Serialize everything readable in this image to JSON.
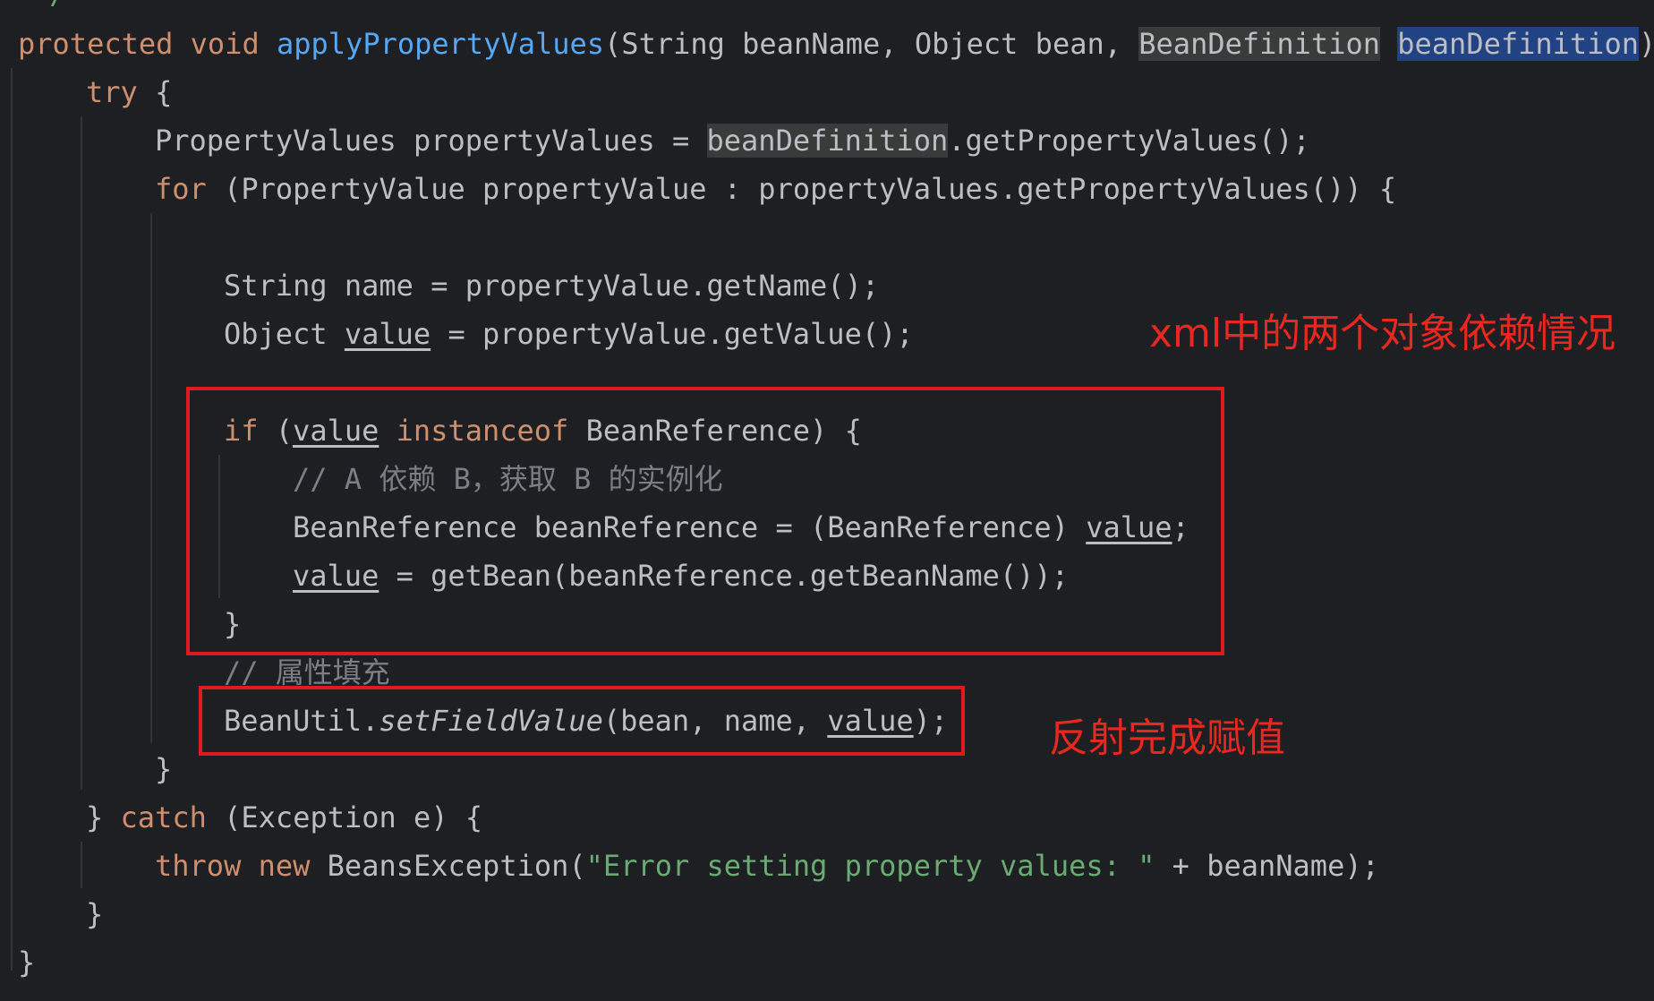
{
  "top_stub": "*/",
  "code": {
    "l1": {
      "mod": "protected",
      "ret": "void",
      "name": "applyPropertyValues",
      "p1": "(String beanName, Object bean, ",
      "ptype": "BeanDefinition",
      "pname": "beanDefinition",
      "close": ")"
    },
    "l2": {
      "kw": "try",
      "rest": " {"
    },
    "l3": {
      "a": "PropertyValues propertyValues = ",
      "b": "beanDefinition",
      "c": ".getPropertyValues();"
    },
    "l4": {
      "kw": "for",
      "rest": " (PropertyValue propertyValue : propertyValues.getPropertyValues()) {"
    },
    "l6": {
      "text": "String name = propertyValue.getName();"
    },
    "l7": {
      "a": "Object ",
      "v": "value",
      "b": " = propertyValue.getValue();"
    },
    "l9": {
      "kw": "if",
      "a": " (",
      "v": "value",
      "kw2": "instanceof",
      "b": " BeanReference) {"
    },
    "l10": {
      "text": "// A 依赖 B，获取 B 的实例化"
    },
    "l11": {
      "a": "BeanReference beanReference = (BeanReference) ",
      "v": "value",
      "b": ";"
    },
    "l12": {
      "v": "value",
      "a": " = getBean(beanReference.getBeanName());"
    },
    "l13": {
      "text": "}"
    },
    "l14": {
      "text": "// 属性填充"
    },
    "l15": {
      "a": "BeanUtil.",
      "fn": "setFieldValue",
      "b": "(bean, name, ",
      "v": "value",
      "c": ");"
    },
    "l16": {
      "text": "}"
    },
    "l17": {
      "a": "} ",
      "kw": "catch",
      "b": " (Exception e) {"
    },
    "l18": {
      "kw1": "throw",
      "kw2": "new",
      "a": " BeansException(",
      "str": "\"Error setting property values: \"",
      "b": " + beanName);"
    },
    "l19": {
      "text": "}"
    },
    "l20": {
      "text": "}"
    }
  },
  "annotations": {
    "dependency": "xml中的两个对象依赖情况",
    "reflection": "反射完成赋值"
  },
  "colors": {
    "background": "#1e1f22",
    "text": "#bcbec4",
    "keyword": "#cf8e6d",
    "method": "#56a8f5",
    "string": "#6aab73",
    "comment": "#7a7e85",
    "annotation_red": "#e0191e"
  }
}
